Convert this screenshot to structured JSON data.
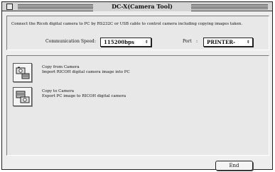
{
  "window": {
    "title": "DC-X(Camera Tool)"
  },
  "description": "Connect the Ricoh digital camera to PC by RS232C or USB cable to control camera including copying images taken.",
  "communication": {
    "label": "Communication Speed",
    "value": "115200bps"
  },
  "port": {
    "label": "Port",
    "value": "PRINTER-"
  },
  "actions": [
    {
      "title": "Copy from Camera",
      "subtitle": "Import RICOH digital camera image into PC",
      "icon": "camera-to-pc-icon"
    },
    {
      "title": "Copy to Camera",
      "subtitle": "Export PC image to RICOH digital camera",
      "icon": "pc-to-camera-icon"
    }
  ],
  "end_button": "End",
  "icons": {
    "close": "close-box-icon",
    "popup_arrow": "up-down-arrow-icon"
  }
}
